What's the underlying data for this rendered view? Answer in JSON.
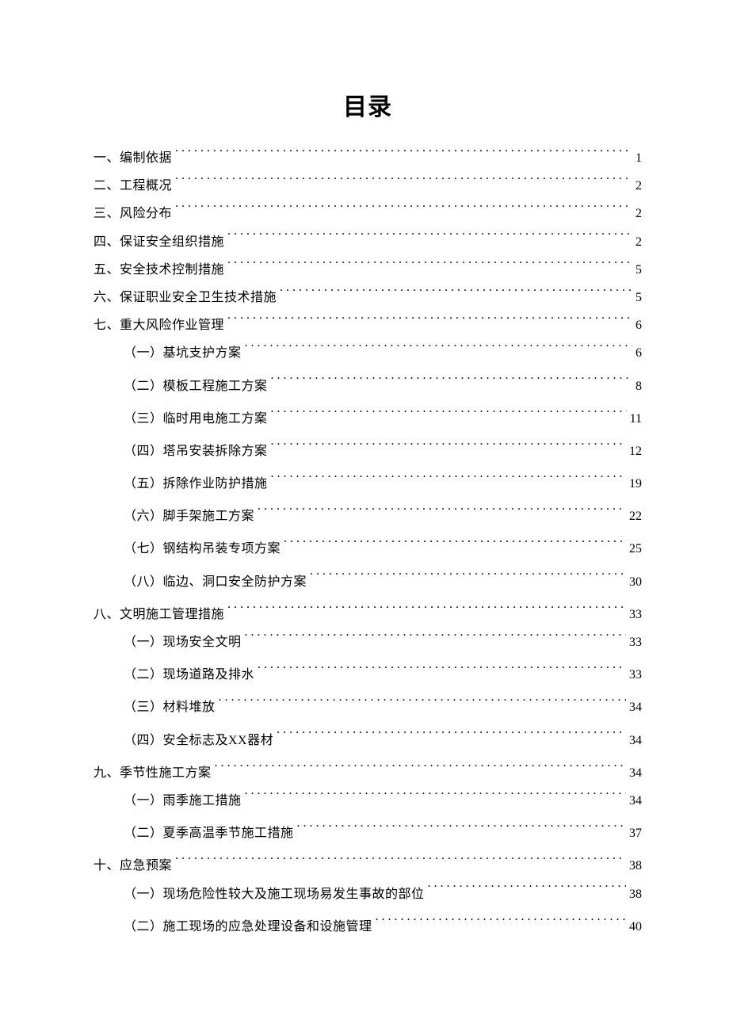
{
  "title": "目录",
  "entries": [
    {
      "label": "一、编制依据",
      "page": "1",
      "level": 0,
      "gap": false
    },
    {
      "label": "二、工程概况",
      "page": "2",
      "level": 0,
      "gap": false
    },
    {
      "label": "三、风险分布",
      "page": "2",
      "level": 0,
      "gap": false
    },
    {
      "label": "四、保证安全组织措施",
      "page": "2",
      "level": 0,
      "gap": false
    },
    {
      "label": "五、安全技术控制措施",
      "page": "5",
      "level": 0,
      "gap": false
    },
    {
      "label": "六、保证职业安全卫生技术措施",
      "page": "5",
      "level": 0,
      "gap": false
    },
    {
      "label": "七、重大风险作业管理",
      "page": "6",
      "level": 0,
      "gap": false
    },
    {
      "label": "（一）基坑支护方案",
      "page": "6",
      "level": 1,
      "gap": false
    },
    {
      "label": "（二）模板工程施工方案",
      "page": "8",
      "level": 1,
      "gap": true
    },
    {
      "label": "（三）临时用电施工方案",
      "page": "11",
      "level": 1,
      "gap": true
    },
    {
      "label": "（四）塔吊安装拆除方案",
      "page": "12",
      "level": 1,
      "gap": true
    },
    {
      "label": "（五）拆除作业防护措施",
      "page": "19",
      "level": 1,
      "gap": true
    },
    {
      "label": "（六）脚手架施工方案",
      "page": "22",
      "level": 1,
      "gap": true
    },
    {
      "label": "（七）钢结构吊装专项方案",
      "page": "25",
      "level": 1,
      "gap": true
    },
    {
      "label": "（八）临边、洞口安全防护方案",
      "page": "30",
      "level": 1,
      "gap": true
    },
    {
      "label": "八、文明施工管理措施",
      "page": "33",
      "level": 0,
      "gap": true
    },
    {
      "label": "（一）现场安全文明",
      "page": "33",
      "level": 1,
      "gap": false
    },
    {
      "label": "（二）现场道路及排水",
      "page": "33",
      "level": 1,
      "gap": true
    },
    {
      "label": "（三）材料堆放",
      "page": "34",
      "level": 1,
      "gap": true
    },
    {
      "label": "（四）安全标志及XX器材",
      "page": "34",
      "level": 1,
      "gap": true
    },
    {
      "label": "九、季节性施工方案",
      "page": "34",
      "level": 0,
      "gap": true
    },
    {
      "label": "（一）雨季施工措施",
      "page": "34",
      "level": 1,
      "gap": false
    },
    {
      "label": "（二）夏季高温季节施工措施",
      "page": "37",
      "level": 1,
      "gap": true
    },
    {
      "label": "十、应急预案",
      "page": "38",
      "level": 0,
      "gap": true
    },
    {
      "label": "（一）现场危险性较大及施工现场易发生事故的部位",
      "page": "38",
      "level": 1,
      "gap": false
    },
    {
      "label": "（二）施工现场的应急处理设备和设施管理",
      "page": "40",
      "level": 1,
      "gap": true
    }
  ]
}
